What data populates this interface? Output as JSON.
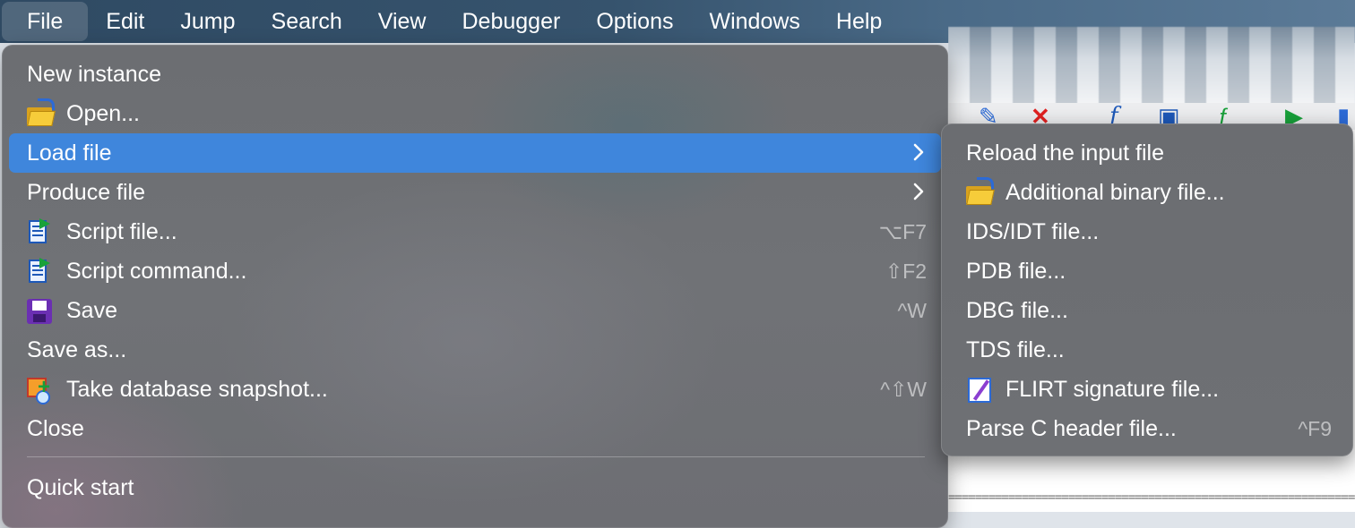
{
  "menubar": {
    "items": [
      {
        "label": "File",
        "active": true
      },
      {
        "label": "Edit"
      },
      {
        "label": "Jump"
      },
      {
        "label": "Search"
      },
      {
        "label": "View"
      },
      {
        "label": "Debugger"
      },
      {
        "label": "Options"
      },
      {
        "label": "Windows"
      },
      {
        "label": "Help"
      }
    ]
  },
  "file_menu": {
    "items": [
      {
        "label": "New instance"
      },
      {
        "label": "Open...",
        "icon": "folder-open-icon"
      },
      {
        "label": "Load file",
        "submenu": true,
        "highlighted": true
      },
      {
        "label": "Produce file",
        "submenu": true
      },
      {
        "label": "Script file...",
        "icon": "script-file-icon",
        "shortcut": "⌥F7"
      },
      {
        "label": "Script command...",
        "icon": "script-command-icon",
        "shortcut": "⇧F2"
      },
      {
        "label": "Save",
        "icon": "floppy-disk-icon",
        "shortcut": "^W"
      },
      {
        "label": "Save as..."
      },
      {
        "label": "Take database snapshot...",
        "icon": "snapshot-icon",
        "shortcut": "^⇧W"
      },
      {
        "label": "Close"
      },
      {
        "label": "Quick start"
      }
    ]
  },
  "load_file_submenu": {
    "items": [
      {
        "label": "Reload the input file"
      },
      {
        "label": "Additional binary file...",
        "icon": "folder-open-icon"
      },
      {
        "label": "IDS/IDT file..."
      },
      {
        "label": "PDB file..."
      },
      {
        "label": "DBG file..."
      },
      {
        "label": "TDS file..."
      },
      {
        "label": "FLIRT signature file...",
        "icon": "flirt-signature-icon"
      },
      {
        "label": "Parse C header file...",
        "shortcut": "^F9"
      }
    ]
  },
  "colors": {
    "highlight": "#3f86dc",
    "menu_text": "#ffffff",
    "shortcut_text": "rgba(255,255,255,0.55)"
  }
}
